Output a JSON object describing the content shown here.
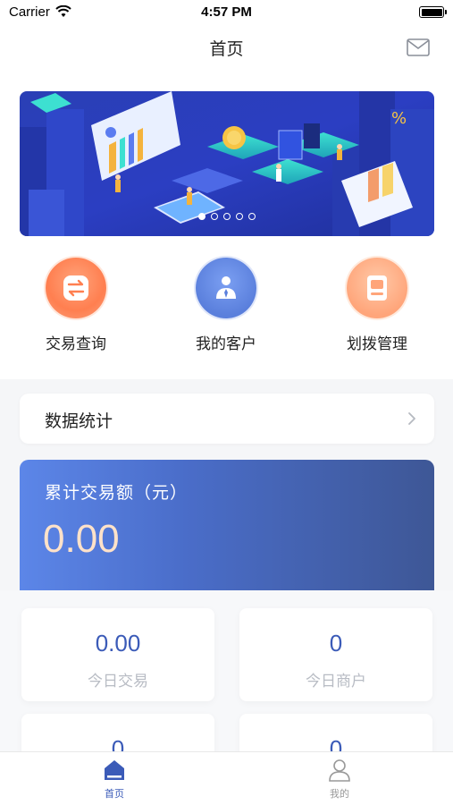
{
  "status_bar": {
    "carrier": "Carrier",
    "time": "4:57 PM"
  },
  "nav": {
    "title": "首页",
    "right_icon": "mail-icon"
  },
  "banner": {
    "dot_count": 5,
    "active_dot": 0
  },
  "quick_actions": [
    {
      "label": "交易查询",
      "icon": "exchange-icon",
      "color": "#ff7f50"
    },
    {
      "label": "我的客户",
      "icon": "customer-icon",
      "color": "#5a7fdc"
    },
    {
      "label": "划拨管理",
      "icon": "transfer-book-icon",
      "color": "#ffa57a"
    }
  ],
  "stats_section": {
    "title": "数据统计"
  },
  "total_card": {
    "label": "累计交易额（元）",
    "value": "0.00"
  },
  "stat_cards": [
    {
      "value": "0.00",
      "label": "今日交易"
    },
    {
      "value": "0",
      "label": "今日商户"
    },
    {
      "value": "0",
      "label": ""
    },
    {
      "value": "0",
      "label": ""
    }
  ],
  "tab_bar": {
    "tabs": [
      {
        "label": "首页",
        "icon": "home-icon",
        "active": true
      },
      {
        "label": "我的",
        "icon": "profile-icon",
        "active": false
      }
    ]
  },
  "colors": {
    "accent": "#3b5bb8",
    "orange": "#ff7f50",
    "peach": "#ffa57a"
  }
}
